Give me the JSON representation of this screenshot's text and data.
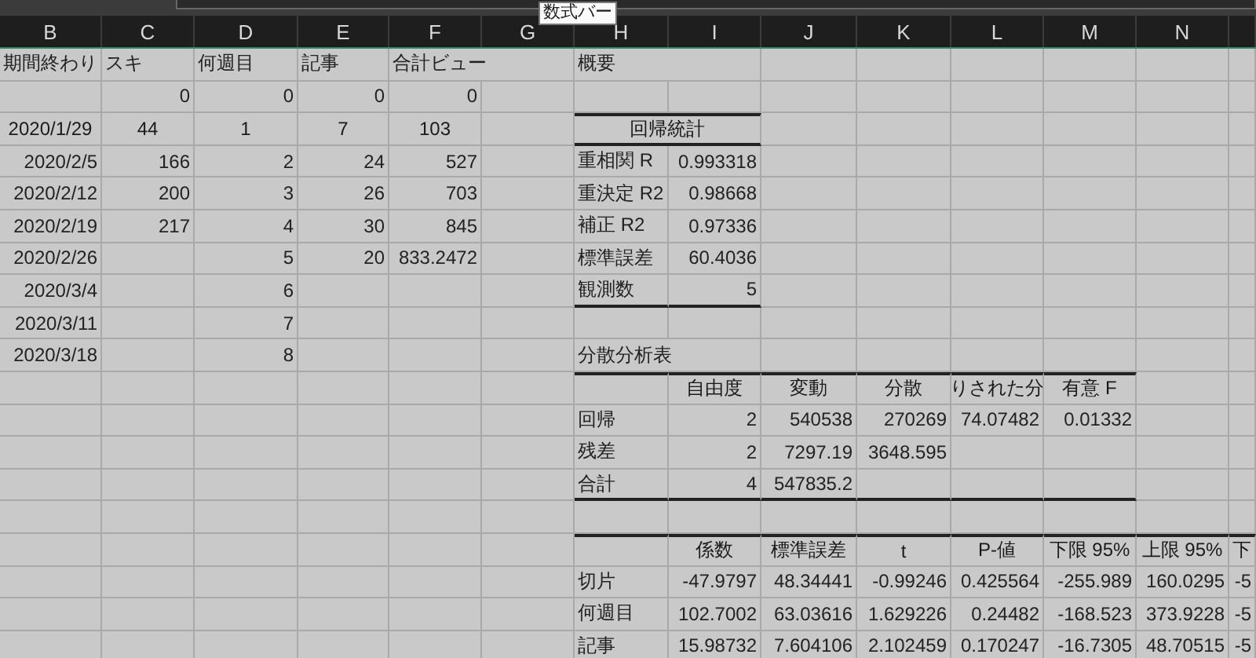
{
  "tooltip": "数式バー",
  "columns": [
    "B",
    "C",
    "D",
    "E",
    "F",
    "G",
    "H",
    "I",
    "J",
    "K",
    "L",
    "M",
    "N"
  ],
  "rows": [
    {
      "kind": "data",
      "rule_top": false,
      "rule_bottom": false,
      "left": {
        "B": "期間終わり",
        "C": "スキ",
        "D": "何週目",
        "E": "記事",
        "F": "合計ビュー"
      },
      "right": {
        "H": "概要"
      }
    },
    {
      "kind": "data",
      "rule_top": false,
      "rule_bottom": false,
      "left": {
        "C": "0",
        "D": "0",
        "E": "0",
        "F": "0"
      },
      "right": {}
    },
    {
      "kind": "title",
      "rule_top": true,
      "rule_bottom": true,
      "left": {
        "B": "2020/1/29",
        "C": "44",
        "D": "1",
        "E": "7",
        "F": "103"
      },
      "right": {
        "H": "回帰統計"
      }
    },
    {
      "kind": "data",
      "rule_top": false,
      "rule_bottom": false,
      "left": {
        "B": "2020/2/5",
        "C": "166",
        "D": "2",
        "E": "24",
        "F": "527"
      },
      "right": {
        "H": "重相関 R",
        "I": "0.993318"
      }
    },
    {
      "kind": "data",
      "rule_top": false,
      "rule_bottom": false,
      "left": {
        "B": "2020/2/12",
        "C": "200",
        "D": "3",
        "E": "26",
        "F": "703"
      },
      "right": {
        "H": "重決定 R2",
        "I": "0.98668"
      }
    },
    {
      "kind": "data",
      "rule_top": false,
      "rule_bottom": false,
      "left": {
        "B": "2020/2/19",
        "C": "217",
        "D": "4",
        "E": "30",
        "F": "845"
      },
      "right": {
        "H": "補正 R2",
        "I": "0.97336"
      }
    },
    {
      "kind": "data",
      "rule_top": false,
      "rule_bottom": false,
      "left": {
        "B": "2020/2/26",
        "D": "5",
        "E": "20",
        "F": "833.2472"
      },
      "right": {
        "H": "標準誤差",
        "I": "60.4036"
      }
    },
    {
      "kind": "data",
      "rule_top": false,
      "rule_bottom": true,
      "left": {
        "B": "2020/3/4",
        "D": "6"
      },
      "right": {
        "H": "観測数",
        "I": "5"
      }
    },
    {
      "kind": "data",
      "rule_top": false,
      "rule_bottom": false,
      "left": {
        "B": "2020/3/11",
        "D": "7"
      },
      "right": {}
    },
    {
      "kind": "data",
      "rule_top": false,
      "rule_bottom": false,
      "left": {
        "B": "2020/3/18",
        "D": "8"
      },
      "right": {
        "H": "分散分析表"
      }
    },
    {
      "kind": "header",
      "rule_top": true,
      "rule_bottom": false,
      "left": {},
      "right": {
        "I": "自由度",
        "J": "変動",
        "K": "分散",
        "L": "りされた分",
        "M": "有意 F"
      }
    },
    {
      "kind": "data",
      "rule_top": false,
      "rule_bottom": false,
      "left": {},
      "right": {
        "H": "回帰",
        "I": "2",
        "J": "540538",
        "K": "270269",
        "L": "74.07482",
        "M": "0.01332"
      }
    },
    {
      "kind": "data",
      "rule_top": false,
      "rule_bottom": false,
      "left": {},
      "right": {
        "H": "残差",
        "I": "2",
        "J": "7297.19",
        "K": "3648.595"
      }
    },
    {
      "kind": "data",
      "rule_top": false,
      "rule_bottom": true,
      "left": {},
      "right": {
        "H": "合計",
        "I": "4",
        "J": "547835.2"
      }
    },
    {
      "kind": "data",
      "rule_top": false,
      "rule_bottom": false,
      "left": {},
      "right": {}
    },
    {
      "kind": "header",
      "rule_top": true,
      "rule_bottom": false,
      "left": {},
      "right": {
        "I": "係数",
        "J": "標準誤差",
        "K": "t",
        "L": "P-値",
        "M": "下限 95%",
        "N": "上限 95%",
        "column_15": "下"
      }
    },
    {
      "kind": "data",
      "rule_top": false,
      "rule_bottom": false,
      "left": {},
      "right": {
        "H": "切片",
        "I": "-47.9797",
        "J": "48.34441",
        "K": "-0.99246",
        "L": "0.425564",
        "M": "-255.989",
        "N": "160.0295",
        "column_15": "-5"
      }
    },
    {
      "kind": "data",
      "rule_top": false,
      "rule_bottom": false,
      "left": {},
      "right": {
        "H": "何週目",
        "I": "102.7002",
        "J": "63.03616",
        "K": "1.629226",
        "L": "0.24482",
        "M": "-168.523",
        "N": "373.9228",
        "column_15": "-5"
      }
    },
    {
      "kind": "data",
      "rule_top": false,
      "rule_bottom": false,
      "left": {},
      "right": {
        "H": "記事",
        "I": "15.98732",
        "J": "7.604106",
        "K": "2.102459",
        "L": "0.170247",
        "M": "-16.7305",
        "N": "48.70515",
        "column_15": "-5"
      }
    }
  ]
}
